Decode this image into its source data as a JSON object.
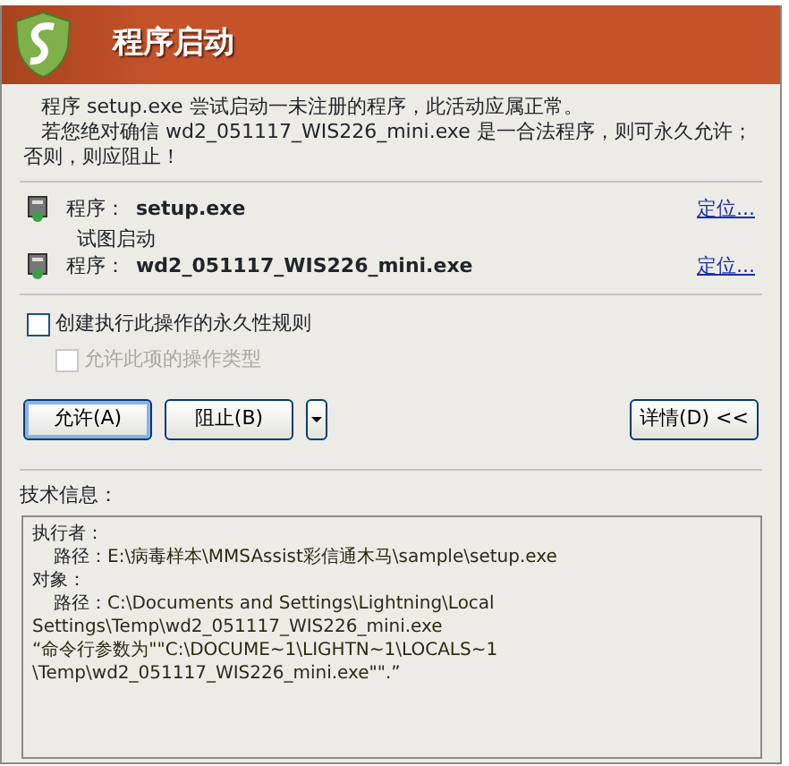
{
  "window": {
    "title": "程序启动"
  },
  "message": [
    "程序 setup.exe 尝试启动一未注册的程序，此活动应属正常。",
    "若您绝对确信 wd2_051117_WIS226_mini.exe 是一合法程序，则可永久允许；否则，则应阻止！"
  ],
  "programs": [
    {
      "label": "程序：",
      "name": "setup.exe",
      "link": "定位..."
    },
    {
      "label": "程序：",
      "name": "wd2_051117_WIS226_mini.exe",
      "link": "定位..."
    }
  ],
  "action": "试图启动",
  "options": [
    {
      "label": "创建执行此操作的永久性规则",
      "checked": false,
      "disabled": false
    },
    {
      "label": "允许此项的操作类型",
      "checked": false,
      "disabled": true
    }
  ],
  "buttons": [
    {
      "label": "允许(A)",
      "kind": "main",
      "selected": true
    },
    {
      "label": "阻止(B)",
      "kind": "split",
      "selected": false
    },
    {
      "label": "详情(D) <<",
      "kind": "right",
      "selected": false
    }
  ],
  "tech_info": {
    "label": "技术信息：",
    "lines": [
      {
        "kind": "heading",
        "text": "执行者："
      },
      {
        "kind": "field",
        "label": "路径：",
        "text": "E:\\病毒样本\\MMSAssist彩信通木马\\sample\\setup.exe"
      },
      {
        "kind": "heading",
        "text": "对象："
      },
      {
        "kind": "field",
        "label": "路径：",
        "text": "C:\\Documents and Settings\\Lightning\\Local"
      },
      {
        "kind": "plain",
        "text": "Settings\\Temp\\wd2_051117_WIS226_mini.exe"
      },
      {
        "kind": "plain",
        "text": "“命令行参数为\"\"C:\\DOCUME~1\\LIGHTN~1\\LOCALS~1"
      },
      {
        "kind": "plain",
        "text": "\\Temp\\wd2_051117_WIS226_mini.exe\"\".”"
      }
    ]
  }
}
